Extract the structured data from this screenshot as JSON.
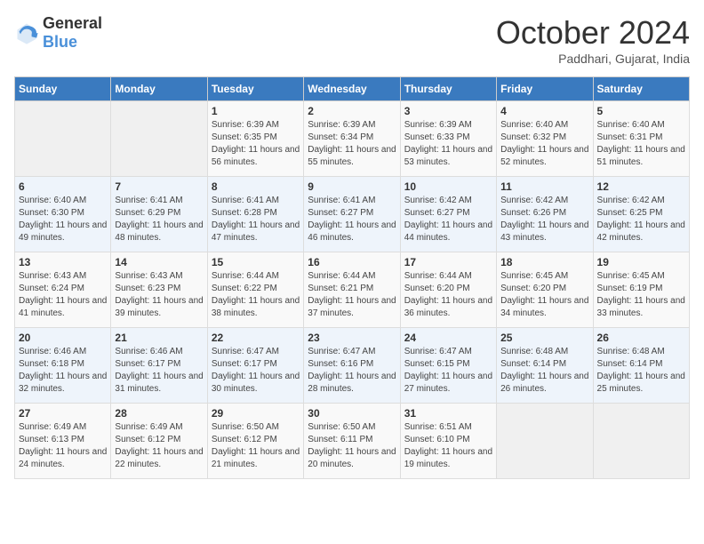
{
  "header": {
    "logo": {
      "general": "General",
      "blue": "Blue"
    },
    "title": "October 2024",
    "location": "Paddhari, Gujarat, India"
  },
  "calendar": {
    "days_of_week": [
      "Sunday",
      "Monday",
      "Tuesday",
      "Wednesday",
      "Thursday",
      "Friday",
      "Saturday"
    ],
    "weeks": [
      [
        {
          "day": "",
          "info": ""
        },
        {
          "day": "",
          "info": ""
        },
        {
          "day": "1",
          "info": "Sunrise: 6:39 AM\nSunset: 6:35 PM\nDaylight: 11 hours and 56 minutes."
        },
        {
          "day": "2",
          "info": "Sunrise: 6:39 AM\nSunset: 6:34 PM\nDaylight: 11 hours and 55 minutes."
        },
        {
          "day": "3",
          "info": "Sunrise: 6:39 AM\nSunset: 6:33 PM\nDaylight: 11 hours and 53 minutes."
        },
        {
          "day": "4",
          "info": "Sunrise: 6:40 AM\nSunset: 6:32 PM\nDaylight: 11 hours and 52 minutes."
        },
        {
          "day": "5",
          "info": "Sunrise: 6:40 AM\nSunset: 6:31 PM\nDaylight: 11 hours and 51 minutes."
        }
      ],
      [
        {
          "day": "6",
          "info": "Sunrise: 6:40 AM\nSunset: 6:30 PM\nDaylight: 11 hours and 49 minutes."
        },
        {
          "day": "7",
          "info": "Sunrise: 6:41 AM\nSunset: 6:29 PM\nDaylight: 11 hours and 48 minutes."
        },
        {
          "day": "8",
          "info": "Sunrise: 6:41 AM\nSunset: 6:28 PM\nDaylight: 11 hours and 47 minutes."
        },
        {
          "day": "9",
          "info": "Sunrise: 6:41 AM\nSunset: 6:27 PM\nDaylight: 11 hours and 46 minutes."
        },
        {
          "day": "10",
          "info": "Sunrise: 6:42 AM\nSunset: 6:27 PM\nDaylight: 11 hours and 44 minutes."
        },
        {
          "day": "11",
          "info": "Sunrise: 6:42 AM\nSunset: 6:26 PM\nDaylight: 11 hours and 43 minutes."
        },
        {
          "day": "12",
          "info": "Sunrise: 6:42 AM\nSunset: 6:25 PM\nDaylight: 11 hours and 42 minutes."
        }
      ],
      [
        {
          "day": "13",
          "info": "Sunrise: 6:43 AM\nSunset: 6:24 PM\nDaylight: 11 hours and 41 minutes."
        },
        {
          "day": "14",
          "info": "Sunrise: 6:43 AM\nSunset: 6:23 PM\nDaylight: 11 hours and 39 minutes."
        },
        {
          "day": "15",
          "info": "Sunrise: 6:44 AM\nSunset: 6:22 PM\nDaylight: 11 hours and 38 minutes."
        },
        {
          "day": "16",
          "info": "Sunrise: 6:44 AM\nSunset: 6:21 PM\nDaylight: 11 hours and 37 minutes."
        },
        {
          "day": "17",
          "info": "Sunrise: 6:44 AM\nSunset: 6:20 PM\nDaylight: 11 hours and 36 minutes."
        },
        {
          "day": "18",
          "info": "Sunrise: 6:45 AM\nSunset: 6:20 PM\nDaylight: 11 hours and 34 minutes."
        },
        {
          "day": "19",
          "info": "Sunrise: 6:45 AM\nSunset: 6:19 PM\nDaylight: 11 hours and 33 minutes."
        }
      ],
      [
        {
          "day": "20",
          "info": "Sunrise: 6:46 AM\nSunset: 6:18 PM\nDaylight: 11 hours and 32 minutes."
        },
        {
          "day": "21",
          "info": "Sunrise: 6:46 AM\nSunset: 6:17 PM\nDaylight: 11 hours and 31 minutes."
        },
        {
          "day": "22",
          "info": "Sunrise: 6:47 AM\nSunset: 6:17 PM\nDaylight: 11 hours and 30 minutes."
        },
        {
          "day": "23",
          "info": "Sunrise: 6:47 AM\nSunset: 6:16 PM\nDaylight: 11 hours and 28 minutes."
        },
        {
          "day": "24",
          "info": "Sunrise: 6:47 AM\nSunset: 6:15 PM\nDaylight: 11 hours and 27 minutes."
        },
        {
          "day": "25",
          "info": "Sunrise: 6:48 AM\nSunset: 6:14 PM\nDaylight: 11 hours and 26 minutes."
        },
        {
          "day": "26",
          "info": "Sunrise: 6:48 AM\nSunset: 6:14 PM\nDaylight: 11 hours and 25 minutes."
        }
      ],
      [
        {
          "day": "27",
          "info": "Sunrise: 6:49 AM\nSunset: 6:13 PM\nDaylight: 11 hours and 24 minutes."
        },
        {
          "day": "28",
          "info": "Sunrise: 6:49 AM\nSunset: 6:12 PM\nDaylight: 11 hours and 22 minutes."
        },
        {
          "day": "29",
          "info": "Sunrise: 6:50 AM\nSunset: 6:12 PM\nDaylight: 11 hours and 21 minutes."
        },
        {
          "day": "30",
          "info": "Sunrise: 6:50 AM\nSunset: 6:11 PM\nDaylight: 11 hours and 20 minutes."
        },
        {
          "day": "31",
          "info": "Sunrise: 6:51 AM\nSunset: 6:10 PM\nDaylight: 11 hours and 19 minutes."
        },
        {
          "day": "",
          "info": ""
        },
        {
          "day": "",
          "info": ""
        }
      ]
    ]
  }
}
